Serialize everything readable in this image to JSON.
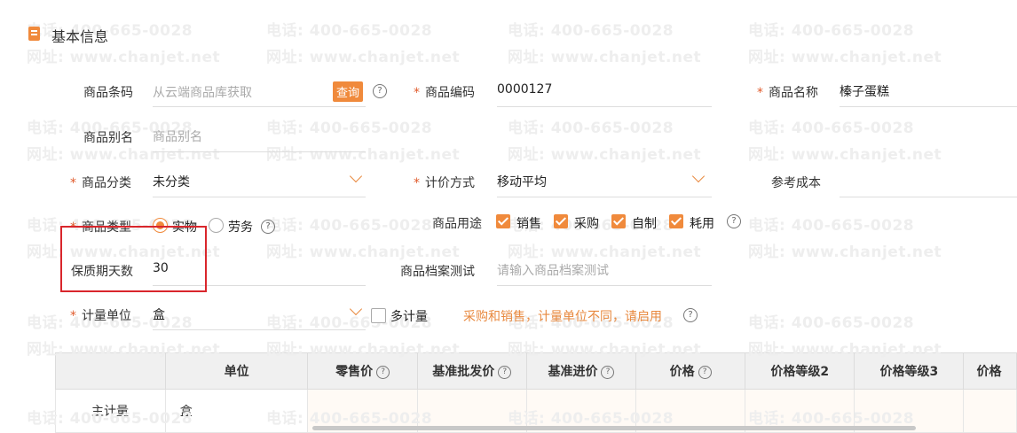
{
  "section": {
    "title": "基本信息"
  },
  "watermark": {
    "phone": "电话: 400-665-0028",
    "site": "网址: www.chanjet.net"
  },
  "colors": {
    "accent": "#f08a3c",
    "required": "#e05a2b",
    "highlight_box": "#d9262c",
    "hint": "#e8893f"
  },
  "form": {
    "barcode": {
      "label": "商品条码",
      "placeholder": "从云端商品库获取",
      "query_button": "查询"
    },
    "code": {
      "label": "商品编码",
      "value": "0000127"
    },
    "name": {
      "label": "商品名称",
      "value": "榛子蛋糕"
    },
    "alias": {
      "label": "商品别名",
      "placeholder": "商品别名"
    },
    "category": {
      "label": "商品分类",
      "value": "未分类"
    },
    "pricing": {
      "label": "计价方式",
      "value": "移动平均"
    },
    "ref_cost": {
      "label": "参考成本",
      "value": ""
    },
    "type": {
      "label": "商品类型",
      "options": [
        "实物",
        "劳务"
      ],
      "selected": "实物"
    },
    "usage": {
      "label": "商品用途",
      "options": [
        "销售",
        "采购",
        "自制",
        "耗用"
      ]
    },
    "shelf_life": {
      "label": "保质期天数",
      "value": "30"
    },
    "archive_test": {
      "label": "商品档案测试",
      "placeholder": "请输入商品档案测试"
    },
    "unit": {
      "label": "计量单位",
      "value": "盒",
      "multi_label": "多计量",
      "hint": "采购和销售，计量单位不同，请启用"
    }
  },
  "table": {
    "headers": [
      "",
      "单位",
      "零售价",
      "基准批发价",
      "基准进价",
      "价格",
      "价格等级2",
      "价格等级3",
      "价格"
    ],
    "rows": [
      [
        "主计量",
        "盒"
      ]
    ]
  }
}
